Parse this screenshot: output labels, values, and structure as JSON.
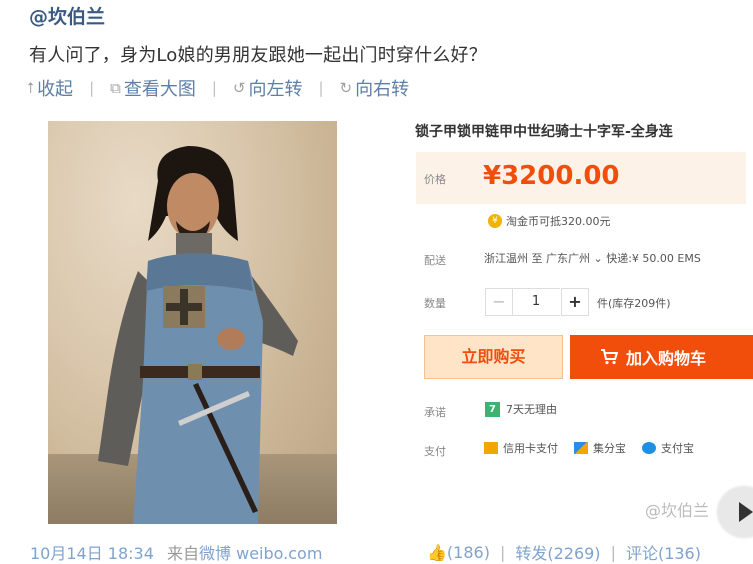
{
  "post": {
    "username": "@坎伯兰",
    "text": "有人问了，身为Lo娘的男朋友跟她一起出门时穿什么好？",
    "actions": [
      {
        "icon": "collapse-up-icon",
        "label": "收起"
      },
      {
        "icon": "view-large-icon",
        "label": "查看大图"
      },
      {
        "icon": "rotate-left-icon",
        "label": "向左转"
      },
      {
        "icon": "rotate-right-icon",
        "label": "向右转"
      }
    ]
  },
  "product": {
    "title": "锁子甲锁甲链甲中世纪骑士十字军-全身连",
    "price_label": "价格",
    "price": "¥3200.00",
    "coin_text": "淘金币可抵320.00元",
    "shipping_label": "配送",
    "shipping_text": "浙江温州 至 广东广州 ⌄ 快递:¥ 50.00 EMS",
    "quantity_label": "数量",
    "quantity": "1",
    "stock_text": "件(库存209件)",
    "buy_now": "立即购买",
    "add_to_cart": "加入购物车",
    "promise_label": "承诺",
    "promise_badge": "7",
    "promise_text": "7天无理由",
    "pay_label": "支付",
    "payments": [
      "信用卡支付",
      "集分宝",
      "支付宝"
    ]
  },
  "watermark": "@坎伯兰",
  "footer": {
    "date": "10月14日 18:34",
    "source_prefix": "来自",
    "source": "微博 weibo.com",
    "likes": "(186)",
    "reposts": "转发(2269)",
    "comments": "评论(136)"
  },
  "colors": {
    "link": "#5d7fa8",
    "price": "#f24e0b",
    "cart_button": "#f24e0b",
    "buy_button_bg": "#ffe4c8",
    "price_bar_bg": "#fdf2e8"
  }
}
